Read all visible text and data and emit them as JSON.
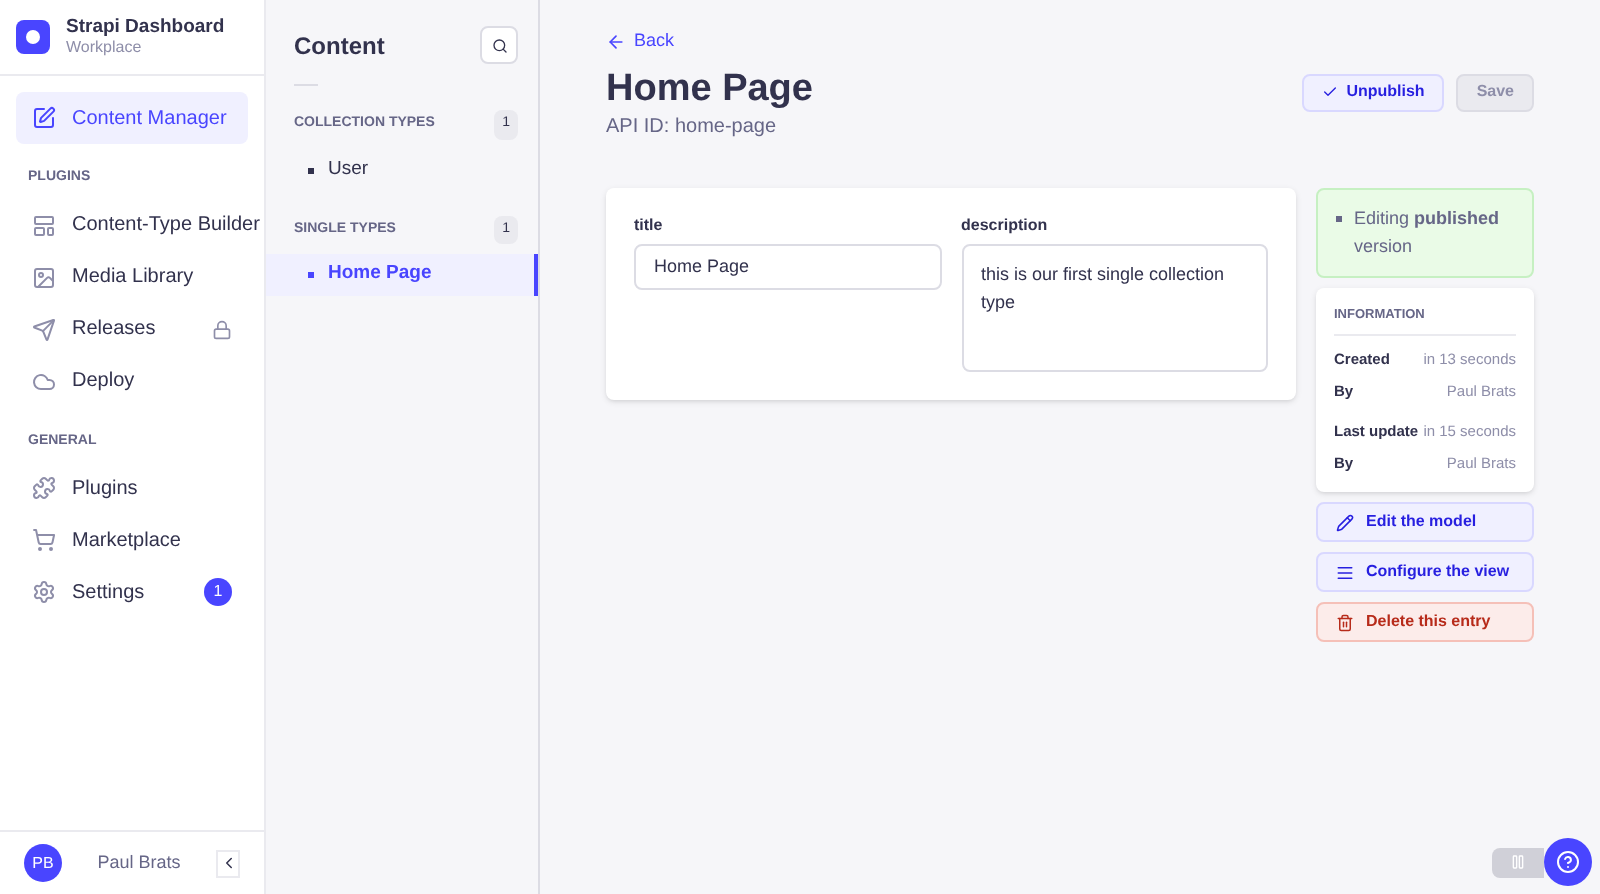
{
  "brand": {
    "title": "Strapi Dashboard",
    "subtitle": "Workplace"
  },
  "nav": [
    {
      "label": "Content Manager",
      "selected": true
    },
    {
      "heading": "PLUGINS",
      "items": [
        {
          "label": "Content-Type Builder",
          "selected": false,
          "locked": false
        },
        {
          "label": "Media Library",
          "selected": false,
          "locked": false
        },
        {
          "label": "Releases",
          "selected": false,
          "locked": true
        },
        {
          "label": "Deploy",
          "selected": false,
          "locked": false
        }
      ]
    },
    {
      "heading": "GENERAL",
      "items": [
        {
          "label": "Plugins",
          "selected": false,
          "locked": false
        },
        {
          "label": "Marketplace",
          "selected": false,
          "locked": false
        },
        {
          "label": "Settings",
          "selected": false,
          "locked": false,
          "badge": "1"
        }
      ]
    }
  ],
  "user": {
    "initials": "PB",
    "name": "Paul Brats"
  },
  "content_panel": {
    "title": "Content",
    "groups": [
      {
        "heading": "COLLECTION TYPES",
        "count": "1",
        "items": [
          {
            "label": "User",
            "selected": false
          }
        ]
      },
      {
        "heading": "SINGLE TYPES",
        "count": "1",
        "items": [
          {
            "label": "Home Page",
            "selected": true
          }
        ]
      }
    ]
  },
  "page": {
    "back": "Back",
    "title": "Home Page",
    "subtitle": "API ID: home-page",
    "unpublish": "Unpublish",
    "save": "Save",
    "fields": [
      {
        "label": "title",
        "kind": "input",
        "value": "Home Page"
      },
      {
        "label": "description",
        "kind": "textarea",
        "value": "this is our first single collection type"
      }
    ],
    "status": "Editing **published** version",
    "info": {
      "heading": "INFORMATION",
      "rows": [
        {
          "label": "Created",
          "value": "in 13 seconds"
        },
        {
          "label": "By",
          "value": "Paul Brats"
        },
        {
          "label": "Last update",
          "value": "in 15 seconds"
        },
        {
          "label": "By",
          "value": "Paul Brats"
        }
      ]
    },
    "actions": [
      {
        "label": "Edit the model",
        "kind": "edit"
      },
      {
        "label": "Configure the view",
        "kind": "configure"
      },
      {
        "label": "Delete this entry",
        "kind": "delete"
      }
    ]
  }
}
